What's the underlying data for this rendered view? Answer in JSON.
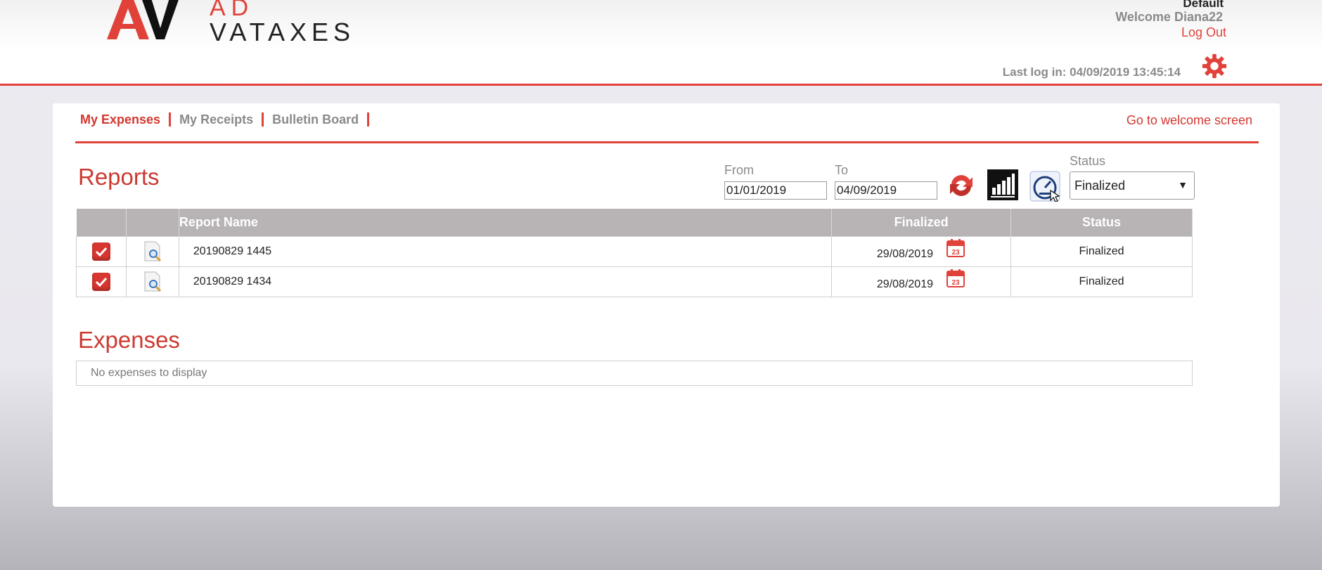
{
  "brand": {
    "mark": "AV",
    "line1": "AD",
    "line2": "VATAXES"
  },
  "user": {
    "company": "Default",
    "welcome": "Welcome Diana22",
    "logout": "Log Out",
    "last_login": "Last log in: 04/09/2019 13:45:14"
  },
  "nav": {
    "tabs": [
      {
        "label": "My Expenses"
      },
      {
        "label": "My Receipts"
      },
      {
        "label": "Bulletin Board"
      }
    ],
    "welcome_link": "Go to welcome screen"
  },
  "reports": {
    "title": "Reports",
    "filters": {
      "from_label": "From",
      "from_value": "01/01/2019",
      "to_label": "To",
      "to_value": "04/09/2019",
      "status_label": "Status",
      "status_value": "Finalized"
    },
    "columns": [
      "",
      "",
      "Report Name",
      "Finalized",
      "Status"
    ],
    "rows": [
      {
        "name": "20190829 1445",
        "finalized": "29/08/2019",
        "status": "Finalized"
      },
      {
        "name": "20190829 1434",
        "finalized": "29/08/2019",
        "status": "Finalized"
      }
    ]
  },
  "expenses": {
    "title": "Expenses",
    "empty_text": "No expenses to display"
  },
  "icons": {
    "settings": "gear-icon",
    "refresh": "refresh-icon",
    "chart": "bar-chart-icon",
    "dashboard": "speedometer-icon",
    "calendar": "calendar-icon",
    "view": "view-report-icon"
  },
  "colors": {
    "accent": "#e0423a",
    "header_gray": "#b8b4b5"
  }
}
